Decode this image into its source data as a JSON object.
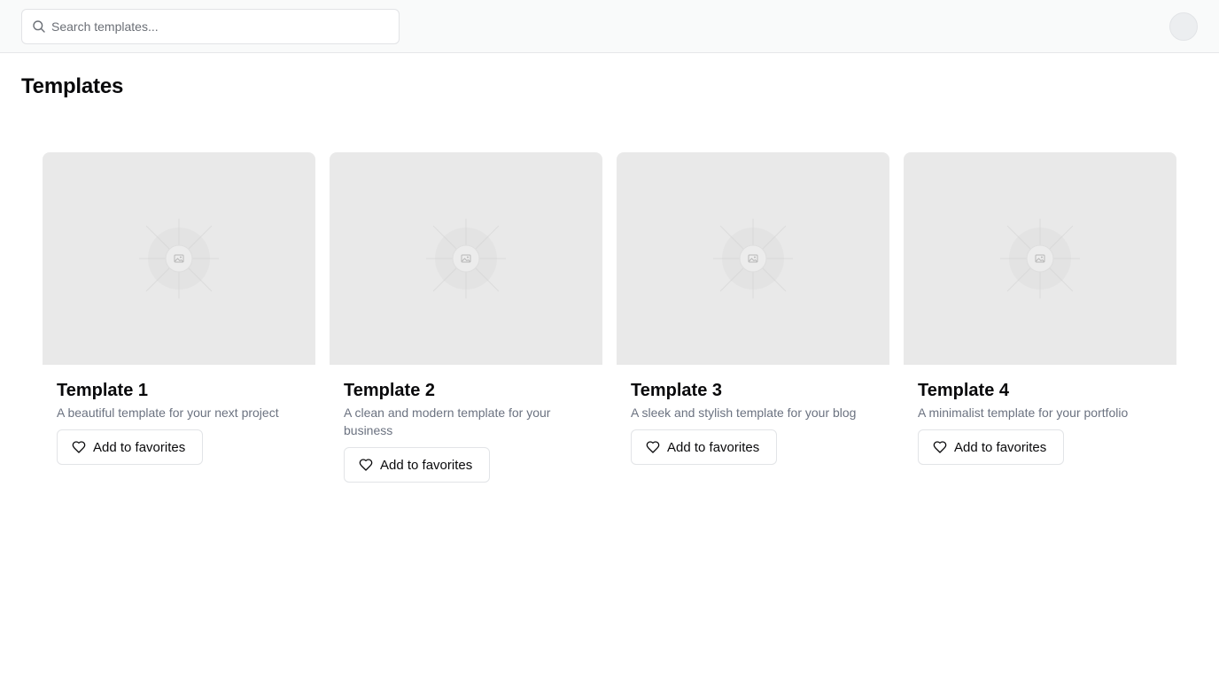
{
  "header": {
    "search": {
      "placeholder": "Search templates...",
      "value": "",
      "icon": "search-icon"
    },
    "avatar": {
      "icon": "avatar"
    }
  },
  "main": {
    "title": "Templates",
    "templates": [
      {
        "title": "Template 1",
        "description": "A beautiful template for your next project",
        "favorite_label": "Add to favorites",
        "image_icon": "image-placeholder-icon"
      },
      {
        "title": "Template 2",
        "description": "A clean and modern template for your business",
        "favorite_label": "Add to favorites",
        "image_icon": "image-placeholder-icon"
      },
      {
        "title": "Template 3",
        "description": "A sleek and stylish template for your blog",
        "favorite_label": "Add to favorites",
        "image_icon": "image-placeholder-icon"
      },
      {
        "title": "Template 4",
        "description": "A minimalist template for your portfolio",
        "favorite_label": "Add to favorites",
        "image_icon": "image-placeholder-icon"
      }
    ]
  },
  "colors": {
    "topbar_bg": "#f9fafa",
    "text": "#09090b",
    "muted_text": "#6b7280",
    "placeholder_bg": "#e9e9e9",
    "border": "#e2e4e7"
  }
}
